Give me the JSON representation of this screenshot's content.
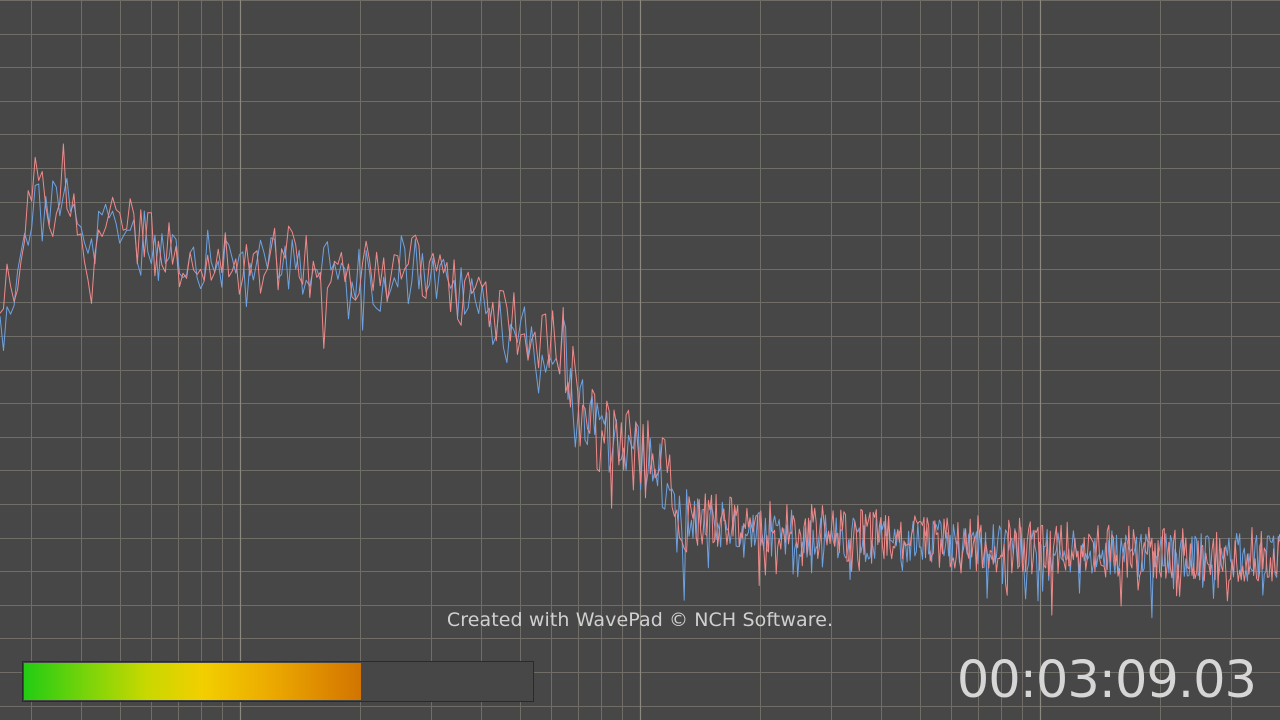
{
  "watermark": "Created with WavePad © NCH Software.",
  "timecode": "00:03:09.03",
  "level": {
    "fraction": 0.66
  },
  "colors": {
    "background": "#474747",
    "grid_minor": "#6f6d66",
    "grid_major": "#8a887f",
    "channel_left": "#f08a8a",
    "channel_right": "#6ea2e0",
    "level_green": "#22cc13",
    "level_yellow": "#f2cf00",
    "level_orange": "#c86a00",
    "timecode": "#d6d6d6"
  },
  "icons": []
}
